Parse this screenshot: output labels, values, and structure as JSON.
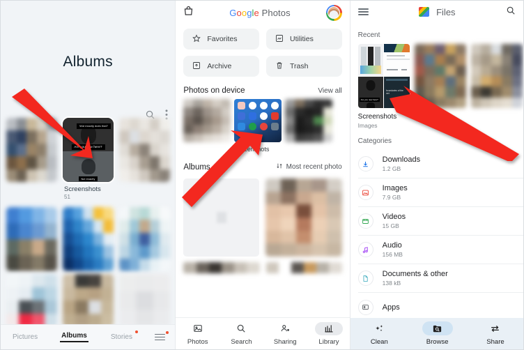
{
  "gallery": {
    "title": "Albums",
    "toolbar": {
      "search_icon": "search-icon",
      "overflow_icon": "more-vertical-icon"
    },
    "albums": [
      {
        "label": "",
        "count": ""
      },
      {
        "label": "Screenshots",
        "count": "51"
      },
      {
        "label": "",
        "count": ""
      },
      {
        "label": "",
        "count": ""
      },
      {
        "label": "",
        "count": ""
      },
      {
        "label": "",
        "count": ""
      }
    ],
    "focus_album": {
      "label": "Screenshots",
      "count": "51",
      "caption_top": "Wut exactly does that?",
      "caption_mid": "Are you new here?",
      "caption_bottom": "Not exactly"
    },
    "tabs": [
      {
        "label": "Pictures",
        "active": false,
        "badge": false
      },
      {
        "label": "Albums",
        "active": true,
        "badge": false
      },
      {
        "label": "Stories",
        "active": false,
        "badge": true
      }
    ],
    "menu": {
      "icon": "hamburger-menu-icon",
      "badge": true
    }
  },
  "photos": {
    "header": {
      "store_icon": "store-bag-icon",
      "brand": {
        "g": "G",
        "o1": "o",
        "o2": "o",
        "g2": "g",
        "l": "l",
        "e": "e",
        "product": "Photos"
      },
      "avatar": "user-avatar"
    },
    "chips": [
      {
        "label": "Favorites",
        "icon": "star-icon"
      },
      {
        "label": "Utilities",
        "icon": "utilities-icon"
      },
      {
        "label": "Archive",
        "icon": "archive-icon"
      },
      {
        "label": "Trash",
        "icon": "trash-icon"
      }
    ],
    "device_section": {
      "title": "Photos on device",
      "link": "View all",
      "items": [
        {
          "label": ""
        },
        {
          "label": "Screenshots"
        },
        {
          "label": ""
        }
      ]
    },
    "albums_section": {
      "title": "Albums",
      "sort_label": "Most recent photo",
      "sort_icon": "sort-icon"
    },
    "tabs": [
      {
        "label": "Photos",
        "icon": "photos-icon",
        "selected": false
      },
      {
        "label": "Search",
        "icon": "search-icon",
        "selected": false
      },
      {
        "label": "Sharing",
        "icon": "sharing-icon",
        "selected": false
      },
      {
        "label": "Library",
        "icon": "library-icon",
        "selected": true
      }
    ]
  },
  "files": {
    "header": {
      "menu_icon": "hamburger-menu-icon",
      "logo": "files-logo-icon",
      "title": "Files",
      "search_icon": "search-icon"
    },
    "recent": {
      "title": "Recent",
      "items": [
        {
          "label": "Screenshots",
          "sub": "Images"
        },
        {
          "label": "",
          "sub": ""
        },
        {
          "label": "",
          "sub": ""
        }
      ]
    },
    "categories": {
      "title": "Categories",
      "items": [
        {
          "name": "Downloads",
          "size": "1.2 GB",
          "icon": "download-icon",
          "color": "#1a73e8"
        },
        {
          "name": "Images",
          "size": "7.9 GB",
          "icon": "image-icon",
          "color": "#ea4335"
        },
        {
          "name": "Videos",
          "size": "15 GB",
          "icon": "video-icon",
          "color": "#34a853"
        },
        {
          "name": "Audio",
          "size": "156 MB",
          "icon": "audio-icon",
          "color": "#a142f4"
        },
        {
          "name": "Documents & other",
          "size": "138 kB",
          "icon": "document-icon",
          "color": "#4fb3c4"
        },
        {
          "name": "Apps",
          "size": "",
          "icon": "apps-icon",
          "color": "#5f6368"
        }
      ]
    },
    "tabs": [
      {
        "label": "Clean",
        "icon": "clean-sparkle-icon",
        "selected": false
      },
      {
        "label": "Browse",
        "icon": "browse-folder-icon",
        "selected": true
      },
      {
        "label": "Share",
        "icon": "share-arrows-icon",
        "selected": false
      }
    ]
  },
  "annotations": {
    "arrows": [
      {
        "name": "arrow-to-gallery-screenshots-album"
      },
      {
        "name": "arrow-to-photos-screenshots-folder"
      },
      {
        "name": "arrow-to-files-screenshots-recent"
      }
    ],
    "color": "#f32f25"
  }
}
